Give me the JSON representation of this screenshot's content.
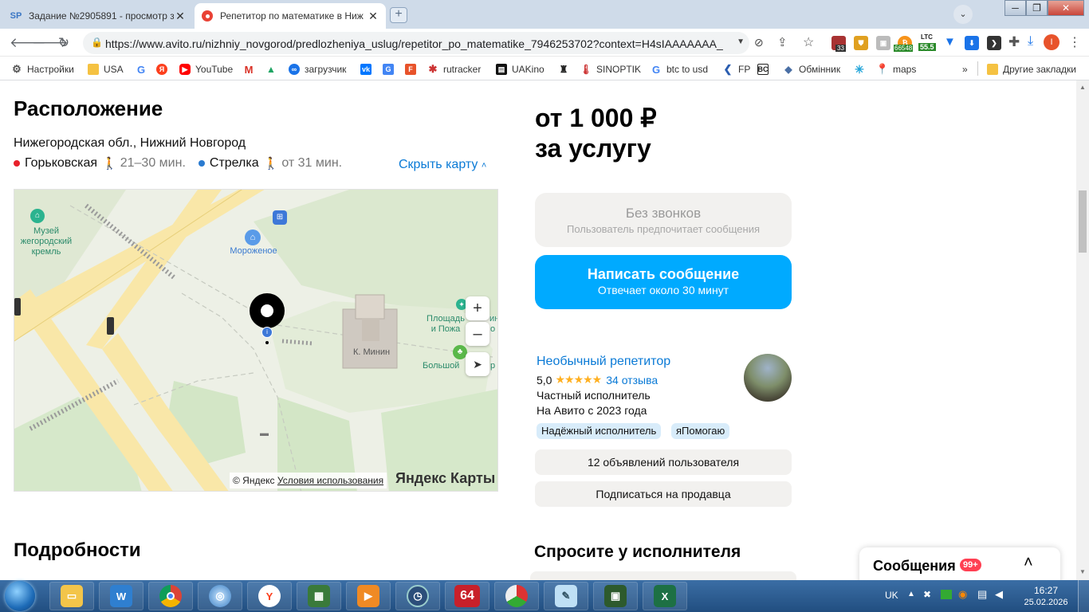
{
  "browser": {
    "tabs": [
      {
        "favicon": "SP",
        "title": "Задание №2905891 - просмотр з",
        "active": false
      },
      {
        "favicon": "record-icon",
        "title": "Репетитор по математике в Ниж",
        "active": true
      }
    ],
    "url": "https://www.avito.ru/nizhniy_novgorod/predlozheniya_uslug/repetitor_po_matematike_7946253702?context=H4sIAAAAAAA_",
    "ext_badges": {
      "b1": "33",
      "b2": "66548",
      "ltc_label": "LTC",
      "ltc_value": "55.5",
      "profile_letter": "I"
    },
    "bookmarks": [
      {
        "icon": "gear-icon",
        "label": "Настройки"
      },
      {
        "icon": "folder-icon",
        "label": "USA"
      },
      {
        "icon": "google-icon",
        "label": ""
      },
      {
        "icon": "yandex-icon",
        "label": ""
      },
      {
        "icon": "youtube-icon",
        "label": "YouTube"
      },
      {
        "icon": "gmail-icon",
        "label": ""
      },
      {
        "icon": "drive-icon",
        "label": ""
      },
      {
        "icon": "link-icon",
        "label": "загрузчик"
      },
      {
        "icon": "vk-icon",
        "label": ""
      },
      {
        "icon": "translate-icon",
        "label": ""
      },
      {
        "icon": "f-icon",
        "label": ""
      },
      {
        "icon": "rutracker-icon",
        "label": "rutracker"
      },
      {
        "icon": "uakino-icon",
        "label": "UAKino"
      },
      {
        "icon": "bottle-icon",
        "label": ""
      },
      {
        "icon": "thermometer-icon",
        "label": "SINOPTIK"
      },
      {
        "icon": "google-icon",
        "label": "btc to usd"
      },
      {
        "icon": "fp-icon",
        "label": "FP"
      },
      {
        "icon": "bc-icon",
        "label": ""
      },
      {
        "icon": "diamond-icon",
        "label": "Обмінник"
      },
      {
        "icon": "star-icon",
        "label": ""
      },
      {
        "icon": "maps-icon",
        "label": "maps"
      },
      {
        "icon": "more-icon",
        "label": "»"
      },
      {
        "icon": "folder-icon",
        "label": "Другие закладки"
      }
    ]
  },
  "location": {
    "title": "Расположение",
    "address": "Нижегородская обл., Нижний Новгород",
    "metro": [
      {
        "name": "Горьковская",
        "time": "21–30 мин.",
        "color": "#e8202a"
      },
      {
        "name": "Стрелка",
        "time": "от 31 мин.",
        "color": "#2a7bd0"
      }
    ],
    "hide_map": "Скрыть карту",
    "map_labels": {
      "museum": "Музей\nжегородский\nкремль",
      "icecream": "Мороженое",
      "minin": "К. Минин",
      "square": "Площадь\nи Пожа",
      "square_tail_1": "ин",
      "square_tail_2": "о",
      "bolshoy": "Большой",
      "bolshoy_tail": "р",
      "copyright": "© Яндекс",
      "terms": "Условия использования",
      "brand": "Яндекс Карты"
    }
  },
  "details": {
    "title": "Подробности"
  },
  "price": {
    "line1": "от 1 000 ₽",
    "line2": "за услугу"
  },
  "no_calls": {
    "title": "Без звонков",
    "subtitle": "Пользователь предпочитает сообщения"
  },
  "write": {
    "title": "Написать сообщение",
    "subtitle": "Отвечает около 30 минут"
  },
  "seller": {
    "name": "Необычный репетитор",
    "rating": "5,0",
    "stars": 5,
    "reviews": "34 отзыва",
    "type": "Частный исполнитель",
    "since": "На Авито с 2023 года",
    "chips": [
      "Надёжный исполнитель",
      "яПомогаю"
    ],
    "listings": "12 объявлений пользователя",
    "subscribe": "Подписаться на продавца"
  },
  "ask": {
    "title": "Спросите у исполнителя"
  },
  "messages": {
    "label": "Сообщения",
    "badge": "99+"
  },
  "colors": {
    "accent": "#00aaff",
    "link": "#0a7ad6",
    "star": "#ffb021"
  },
  "taskbar": {
    "apps": [
      "start-orb",
      "explorer-icon",
      "wise-icon",
      "chrome-icon",
      "network-icon",
      "yandex-browser-icon",
      "game-icon",
      "media-icon",
      "clock-icon",
      "64-icon",
      "arrows-icon",
      "note-icon",
      "monitor-icon",
      "excel-icon"
    ],
    "app64": "64",
    "lang": "UK",
    "time": "16:27",
    "date": "25.02.2026"
  }
}
